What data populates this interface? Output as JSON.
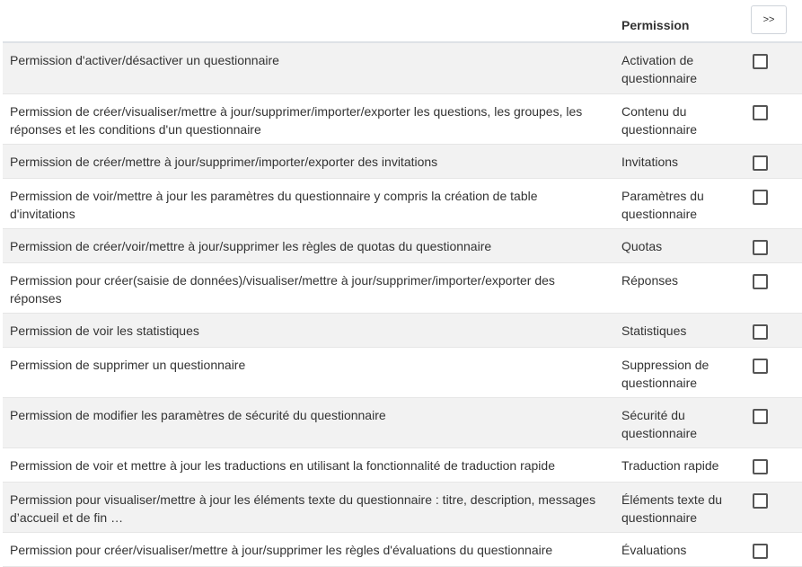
{
  "header": {
    "desc_label": "",
    "permission_label": "Permission",
    "expand_button_label": ">>"
  },
  "rows": [
    {
      "description": "Permission d'activer/désactiver un questionnaire",
      "permission": "Activation de questionnaire",
      "checked": false
    },
    {
      "description": "Permission de créer/visualiser/mettre à jour/supprimer/importer/exporter les questions, les groupes, les réponses et les conditions d'un questionnaire",
      "permission": "Contenu du questionnaire",
      "checked": false
    },
    {
      "description": "Permission de créer/mettre à jour/supprimer/importer/exporter des invitations",
      "permission": "Invitations",
      "checked": false
    },
    {
      "description": "Permission de voir/mettre à jour les paramètres du questionnaire y compris la création de table d'invitations",
      "permission": "Paramètres du questionnaire",
      "checked": false
    },
    {
      "description": "Permission de créer/voir/mettre à jour/supprimer les règles de quotas du questionnaire",
      "permission": "Quotas",
      "checked": false
    },
    {
      "description": "Permission pour créer(saisie de données)/visualiser/mettre à jour/supprimer/importer/exporter des réponses",
      "permission": "Réponses",
      "checked": false
    },
    {
      "description": "Permission de voir les statistiques",
      "permission": "Statistiques",
      "checked": false
    },
    {
      "description": "Permission de supprimer un questionnaire",
      "permission": "Suppression de questionnaire",
      "checked": false
    },
    {
      "description": "Permission de modifier les paramètres de sécurité du questionnaire",
      "permission": "Sécurité du questionnaire",
      "checked": false
    },
    {
      "description": "Permission de voir et mettre à jour les traductions en utilisant la fonctionnalité de traduction rapide",
      "permission": "Traduction rapide",
      "checked": false
    },
    {
      "description": "Permission pour visualiser/mettre à jour les éléments texte du questionnaire : titre, description, messages d’accueil et de fin …",
      "permission": "Éléments texte du questionnaire",
      "checked": false
    },
    {
      "description": "Permission pour créer/visualiser/mettre à jour/supprimer les règles d'évaluations du questionnaire",
      "permission": "Évaluations",
      "checked": false
    }
  ]
}
